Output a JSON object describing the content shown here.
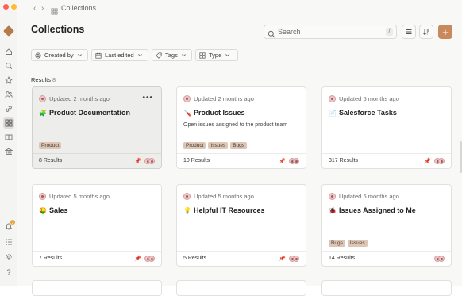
{
  "breadcrumb": {
    "label": "Collections"
  },
  "page": {
    "title": "Collections"
  },
  "search": {
    "placeholder": "Search",
    "shortcut": "/"
  },
  "filters": [
    {
      "label": "Created by"
    },
    {
      "label": "Last edited"
    },
    {
      "label": "Tags"
    },
    {
      "label": "Type"
    }
  ],
  "results": {
    "label": "Results",
    "count": "8"
  },
  "cards": [
    {
      "updated": "Updated 2 months ago",
      "emoji": "🧩",
      "title": "Product Documentation",
      "description": "",
      "tags": [
        "Product"
      ],
      "footer": "8 Results"
    },
    {
      "updated": "Updated 2 months ago",
      "emoji": "🪛",
      "title": "Product Issues",
      "description": "Open issues assigned to the product team",
      "tags": [
        "Product",
        "Issues",
        "Bugs"
      ],
      "footer": "10 Results"
    },
    {
      "updated": "Updated 5 months ago",
      "emoji": "📄",
      "title": "Salesforce Tasks",
      "description": "",
      "tags": [],
      "footer": "317 Results"
    },
    {
      "updated": "Updated 5 months ago",
      "emoji": "🤑",
      "title": "Sales",
      "description": "",
      "tags": [],
      "footer": "7 Results"
    },
    {
      "updated": "Updated 5 months ago",
      "emoji": "💡",
      "title": "Helpful IT Resources",
      "description": "",
      "tags": [],
      "footer": "5 Results"
    },
    {
      "updated": "Updated 5 months ago",
      "emoji": "🐞",
      "title": "Issues Assigned to Me",
      "description": "",
      "tags": [
        "Bugs",
        "Issues"
      ],
      "footer": "14 Results"
    }
  ],
  "notifications": {
    "badge": "2"
  },
  "colors": {
    "accent": "#c88a5c",
    "tag_bg": "#ddc6b6"
  }
}
